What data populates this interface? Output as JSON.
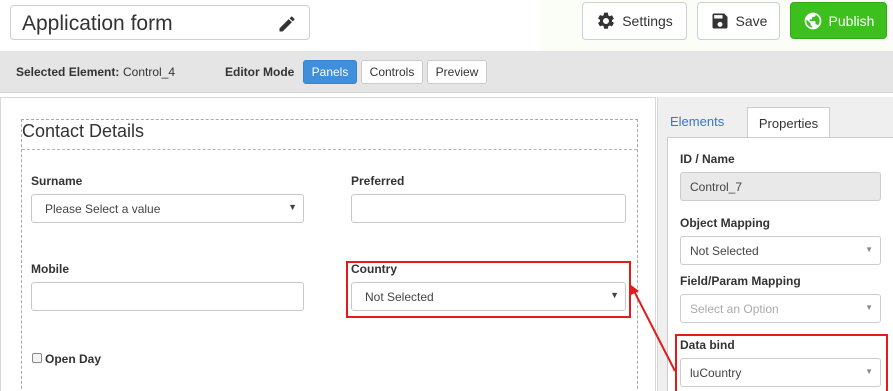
{
  "header": {
    "form_title": "Application form",
    "settings_label": "Settings",
    "save_label": "Save",
    "publish_label": "Publish"
  },
  "toolbar": {
    "selected_element_label": "Selected Element:",
    "selected_element_value": "Control_4",
    "editor_mode_label": "Editor Mode",
    "modes": [
      "Panels",
      "Controls",
      "Preview"
    ],
    "active_mode": "Panels"
  },
  "panel": {
    "title": "Contact Details",
    "fields": {
      "surname_label": "Surname",
      "surname_value": "Please Select a value",
      "preferred_label": "Preferred",
      "preferred_value": "",
      "mobile_label": "Mobile",
      "mobile_value": "",
      "country_label": "Country",
      "country_value": "Not Selected",
      "open_day_label": "Open Day",
      "open_day_checked": false
    }
  },
  "sidebar": {
    "tabs": [
      "Elements",
      "Properties"
    ],
    "active_tab": "Properties",
    "id_name_label": "ID / Name",
    "id_name_value": "Control_7",
    "object_mapping_label": "Object Mapping",
    "object_mapping_value": "Not Selected",
    "field_param_label": "Field/Param Mapping",
    "field_param_placeholder": "Select an Option",
    "data_bind_label": "Data bind",
    "data_bind_value": "luCountry"
  },
  "colors": {
    "publish_green": "#3bc01d",
    "active_mode_blue": "#3f8fdd",
    "annotation_red": "#e11c1c",
    "tab_link_blue": "#3578c2"
  },
  "icons": {
    "pencil": "pencil-icon",
    "settings": "gear-icon",
    "save": "floppy-disk-icon",
    "publish": "globe-icon",
    "dropdown": "caret-down-icon"
  }
}
